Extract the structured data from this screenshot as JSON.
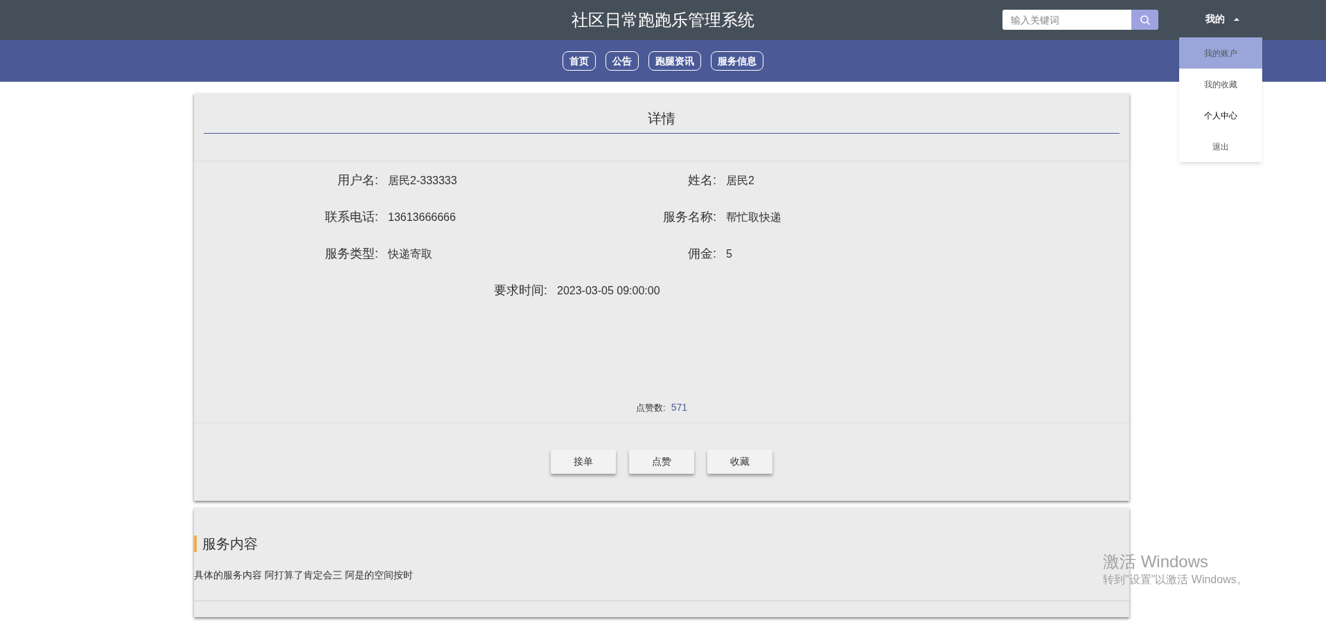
{
  "header": {
    "title": "社区日常跑跑乐管理系统",
    "search": {
      "placeholder": "输入关键词"
    },
    "account_menu": {
      "label": "我的",
      "expanded": true
    }
  },
  "dropdown": [
    {
      "label": "我的账户",
      "selected": true
    },
    {
      "label": "我的收藏",
      "selected": false
    },
    {
      "label": "个人中心",
      "selected": false
    },
    {
      "label": "退出",
      "selected": false
    }
  ],
  "nav": [
    "首页",
    "公告",
    "跑腿资讯",
    "服务信息"
  ],
  "detail": {
    "title": "详情",
    "fields": [
      {
        "kind": "half",
        "label": "用户名:",
        "value": "居民2-333333"
      },
      {
        "kind": "half",
        "label": "姓名:",
        "value": "居民2"
      },
      {
        "kind": "half",
        "label": "联系电话:",
        "value": "13613666666"
      },
      {
        "kind": "half",
        "label": "服务名称:",
        "value": "帮忙取快递"
      },
      {
        "kind": "half",
        "label": "服务类型:",
        "value": "快递寄取"
      },
      {
        "kind": "half",
        "label": "佣金:",
        "value": "5"
      },
      {
        "kind": "wide",
        "label": "要求时间:",
        "value": "2023-03-05 09:00:00"
      }
    ],
    "likes": {
      "label": "点赞数:",
      "value": "571"
    },
    "buttons": [
      "接单",
      "点赞",
      "收藏"
    ]
  },
  "content": {
    "heading": "服务内容",
    "text": "具体的服务内容 阿打算了肯定会三 阿是的空间按时"
  },
  "os_notice": {
    "title": "激活 Windows",
    "subtitle": "转到\"设置\"以激活 Windows。"
  }
}
